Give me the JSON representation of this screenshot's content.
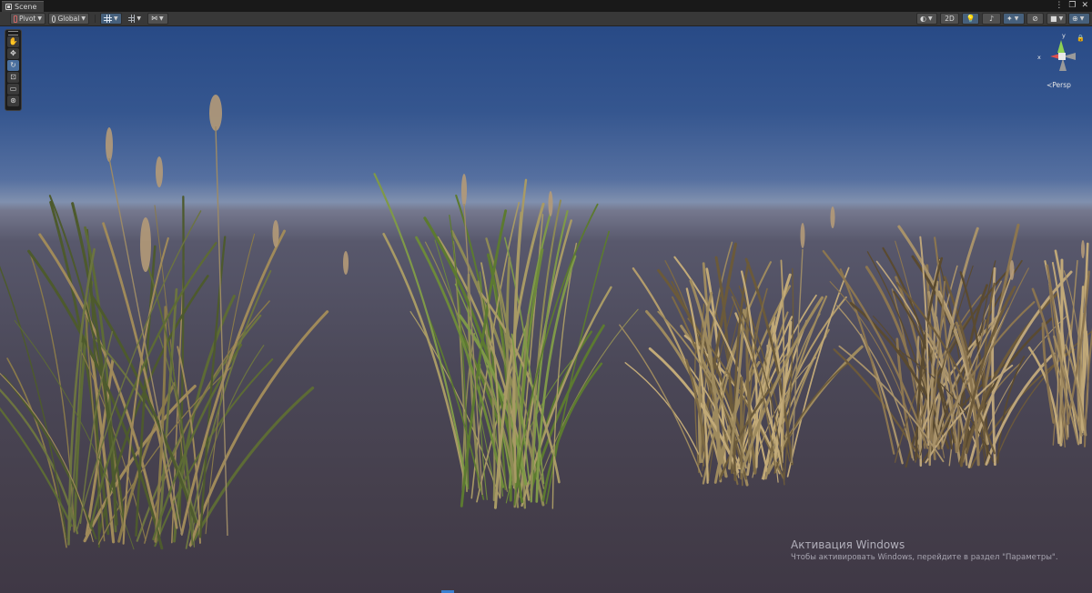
{
  "tab": {
    "title": "Scene",
    "icon": "scene-icon"
  },
  "window_actions": [
    "⋮",
    "❐",
    "✕"
  ],
  "toolbar": {
    "pivot_label": "Pivot",
    "global_label": "Global",
    "mode_2d_label": "2D"
  },
  "palette": {
    "tools": [
      "hand-tool-icon",
      "move-tool-icon",
      "rotate-tool-icon",
      "scale-tool-icon",
      "rect-tool-icon",
      "transform-tool-icon"
    ],
    "active_index": 2
  },
  "gizmo": {
    "x_label": "x",
    "y_label": "y",
    "projection_label": "Persp",
    "colors": {
      "x": "#e0504e",
      "y": "#8ed153",
      "z": "#4a7bd4"
    }
  },
  "watermark": {
    "title": "Активация Windows",
    "subtitle": "Чтобы активировать Windows, перейдите в раздел \"Параметры\"."
  }
}
